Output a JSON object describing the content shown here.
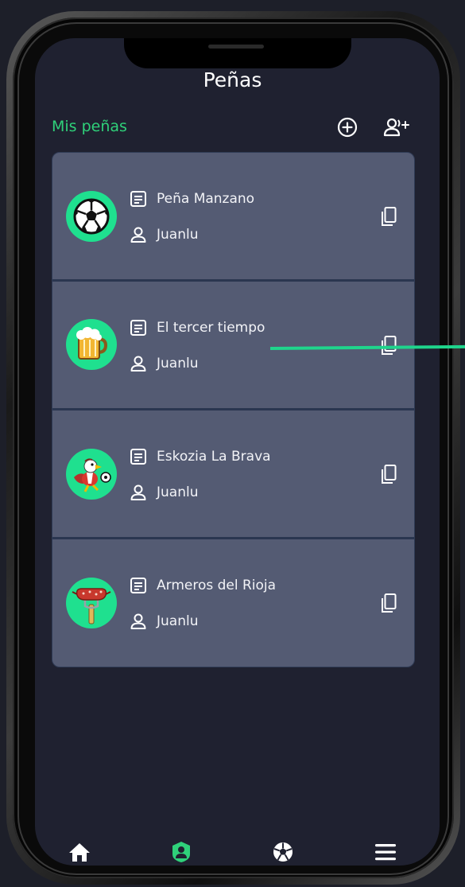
{
  "header": {
    "title": "Peñas"
  },
  "section": {
    "label": "Mis peñas"
  },
  "colors": {
    "accent": "#2fd17a",
    "card": "#545b73",
    "avatar_bg": "#1fe08f",
    "background": "#1f2130"
  },
  "penas": [
    {
      "name": "Peña Manzano",
      "owner": "Juanlu",
      "avatar": "soccer-ball"
    },
    {
      "name": "El tercer tiempo",
      "owner": "Juanlu",
      "avatar": "beer-mug"
    },
    {
      "name": "Eskozia La Brava",
      "owner": "Juanlu",
      "avatar": "eagle-mascot"
    },
    {
      "name": "Armeros del Rioja",
      "owner": "Juanlu",
      "avatar": "chorizo-fork"
    }
  ],
  "tabbar": [
    {
      "icon": "home-icon",
      "active": false
    },
    {
      "icon": "group-icon",
      "active": true
    },
    {
      "icon": "soccer-ball-icon",
      "active": false
    },
    {
      "icon": "menu-icon",
      "active": false
    }
  ]
}
